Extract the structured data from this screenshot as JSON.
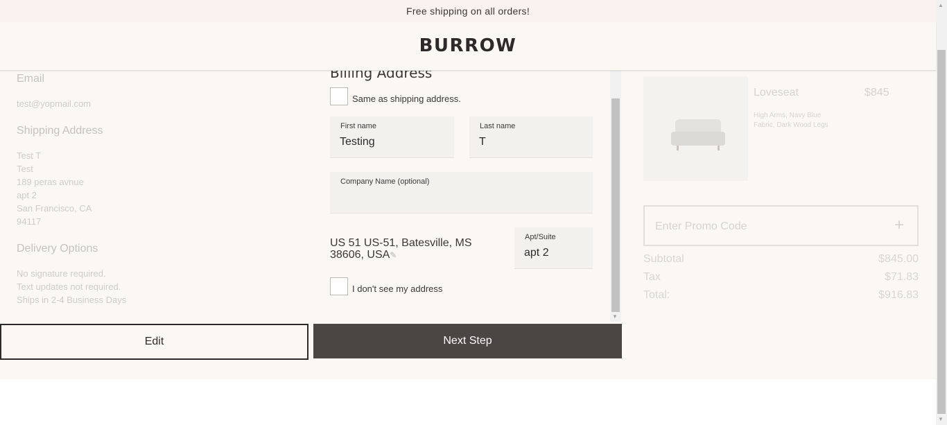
{
  "promo_bar": {
    "text": "Free shipping on all orders!"
  },
  "header": {
    "logo": "BURROW"
  },
  "summary": {
    "email_heading": "Email",
    "email_value": "test@yopmail.com",
    "shipping_heading": "Shipping Address",
    "shipping_lines": [
      "Test T",
      "Test",
      "189 peras avnue",
      "apt 2",
      "San Francisco, CA",
      "94117"
    ],
    "delivery_heading": "Delivery Options",
    "delivery_lines": [
      "No signature required.",
      "Text updates not required.",
      "Ships in 2-4 Business Days"
    ]
  },
  "billing": {
    "title": "Billing Address",
    "same_as_shipping_label": "Same as shipping address.",
    "same_as_shipping_checked": false,
    "first_name": {
      "label": "First name",
      "value": "Testing"
    },
    "last_name": {
      "label": "Last name",
      "value": "T"
    },
    "company": {
      "label": "Company Name (optional)",
      "value": ""
    },
    "address": {
      "line1": "US 51 US-51, Batesville, MS",
      "line2": "38606, USA"
    },
    "apt": {
      "label": "Apt/Suite",
      "value": "apt 2"
    },
    "no_address_label": "I don't see my address",
    "no_address_checked": false
  },
  "actions": {
    "edit_label": "Edit",
    "next_label": "Next Step"
  },
  "order": {
    "product_name": "Loveseat",
    "product_price": "$845",
    "product_desc": "High Arms, Navy Blue Fabric, Dark Wood Legs",
    "promo_placeholder": "Enter Promo Code",
    "promo_icon": "plus-icon",
    "subtotal_label": "Subtotal",
    "subtotal_value": "$845.00",
    "tax_label": "Tax",
    "tax_value": "$71.83",
    "total_label": "Total:",
    "total_value": "$916.83"
  },
  "icons": {
    "edit_address": "pencil-icon"
  },
  "colors": {
    "primary_button": "#4a4643",
    "background": "#fbf8f4",
    "promo_bar": "#f9f2ee"
  }
}
